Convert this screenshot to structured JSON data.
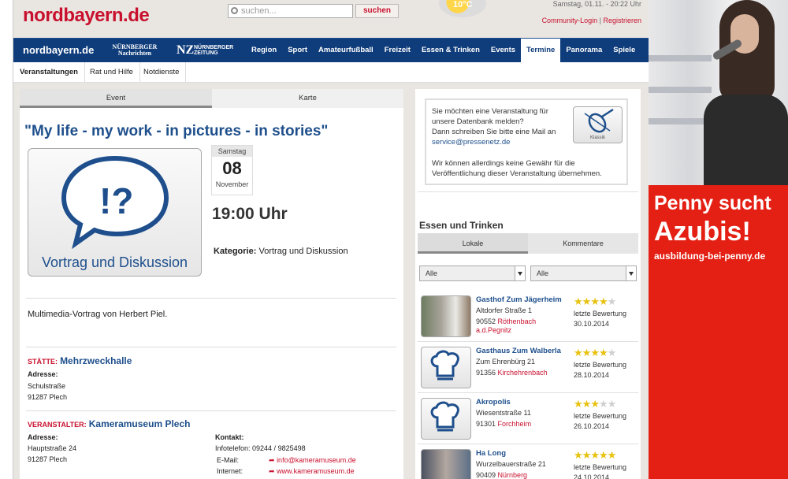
{
  "header": {
    "logo": "nordbayern.de",
    "search_placeholder": "suchen...",
    "search_button": "suchen",
    "weather_temp": "10°C",
    "datetime": "Samstag, 01.11. - 20:22 Uhr",
    "community_login": "Community-Login",
    "separator": "|",
    "register": "Registrieren"
  },
  "nav": {
    "brand": "nordbayern.de",
    "nn_logo": "NÜRNBERGER Nachrichten",
    "nz_logo": "NZ",
    "nz_sub": "NÜRNBERGER ZEITUNG",
    "items": [
      "Region",
      "Sport",
      "Amateurfußball",
      "Freizeit",
      "Essen & Trinken",
      "Events",
      "Termine",
      "Panorama",
      "Spiele"
    ],
    "active": "Termine"
  },
  "subnav": [
    "Veranstaltungen",
    "Rat und Hilfe",
    "Notdienste"
  ],
  "event": {
    "tabs": [
      "Event",
      "Karte"
    ],
    "title": "\"My life - my work - in pictures - in stories\"",
    "image_caption": "Vortrag und Diskussion",
    "date": {
      "dow": "Samstag",
      "day": "08",
      "month": "November"
    },
    "time": "19:00  Uhr",
    "category_label": "Kategorie:",
    "category": "Vortrag und Diskussion",
    "description": "Multimedia-Vortrag von Herbert Piel.",
    "venue_label": "STÄTTE:",
    "venue_name": "Mehrzweckhalle",
    "address_label": "Adresse:",
    "venue_street": "Schulstraße",
    "venue_city": "91287 Plech",
    "organizer_label": "VERANSTALTER:",
    "organizer_name": "Kameramuseum Plech",
    "org_street": "Hauptstraße 24",
    "org_city": "91287 Plech",
    "contact_label": "Kontakt:",
    "phone": "Infotelefon: 09244 / 9825498",
    "email_label": "E-Mail:",
    "email": "info@kameramuseum.de",
    "web_label": "Internet:",
    "web": "www.kameramuseum.de"
  },
  "infobox": {
    "line1": "Sie möchten eine Veranstaltung für",
    "line2": "unsere Datenbank melden?",
    "line3": "Dann schreiben Sie bitte eine Mail an",
    "email": "service@pressenetz.de",
    "line4": "Wir können allerdings keine Gewähr für die",
    "line5": "Veröffentlichung dieser Veranstaltung übernehmen.",
    "image_label": "Klassik"
  },
  "dining": {
    "title": "Essen und Trinken",
    "tabs": [
      "Lokale",
      "Kommentare"
    ],
    "filter1": "Alle",
    "filter2": "Alle",
    "rating_label": "letzte Bewertung",
    "restaurants": [
      {
        "name": "Gasthof Zum Jägerheim",
        "street": "Altdorfer Straße 1",
        "zip": "90552",
        "city": "Röthenbach a.d.Pegnitz",
        "stars": 4,
        "date": "30.10.2014"
      },
      {
        "name": "Gasthaus Zum Walberla",
        "street": "Zum Ehrenbürg 21",
        "zip": "91356",
        "city": "Kirchehrenbach",
        "stars": 4,
        "date": "28.10.2014"
      },
      {
        "name": "Akropolis",
        "street": "Wiesentstraße 11",
        "zip": "91301",
        "city": "Forchheim",
        "stars": 3,
        "date": "26.10.2014"
      },
      {
        "name": "Ha Long",
        "street": "Wurzelbauerstraße 21",
        "zip": "90409",
        "city": "Nürnberg",
        "stars": 5,
        "date": "24.10.2014"
      }
    ]
  },
  "ad": {
    "line1": "Penny sucht",
    "line2": "Azubis!",
    "url": "ausbildung-bei-penny.de"
  },
  "colors": {
    "brand_red": "#c8102e",
    "nav_blue": "#0f3c7a",
    "link_blue": "#1e4f8c",
    "ad_red": "#e41f13",
    "star_yellow": "#e8c20e"
  }
}
